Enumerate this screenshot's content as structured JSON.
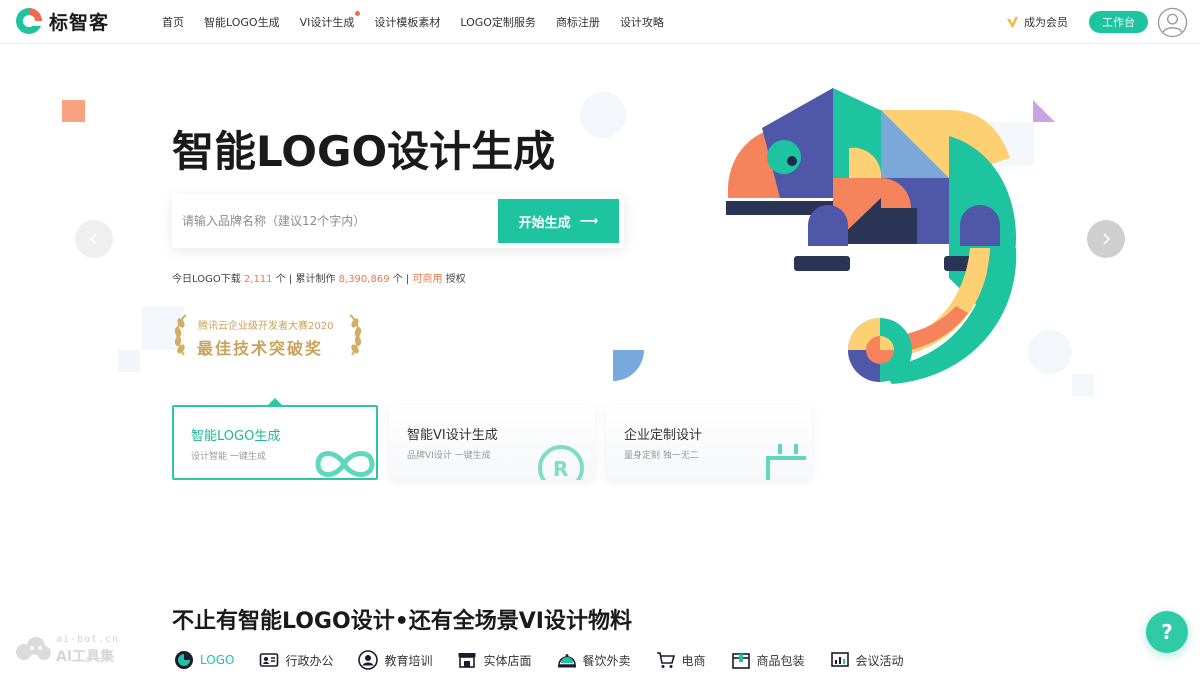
{
  "brand": {
    "name": "标智客",
    "color_primary": "#1ec4a0",
    "color_accent": "#f0784b"
  },
  "nav": {
    "items": [
      {
        "label": "首页"
      },
      {
        "label": "智能LOGO生成"
      },
      {
        "label": "VI设计生成",
        "dot": true
      },
      {
        "label": "设计模板素材"
      },
      {
        "label": "LOGO定制服务"
      },
      {
        "label": "商标注册"
      },
      {
        "label": "设计攻略"
      }
    ],
    "vip_label": "成为会员",
    "workbench_label": "工作台"
  },
  "hero": {
    "title": "智能LOGO设计生成",
    "search": {
      "placeholder": "请输入品牌名称（建议12个字内）",
      "value": "",
      "button_label": "开始生成",
      "button_arrow": "⟶"
    },
    "stats": {
      "prefix": "今日LOGO下载",
      "downloads": "2,111",
      "unit1": "个 | 累计制作",
      "total": "8,390,869",
      "unit2": "个 |",
      "commercial": "可商用",
      "suffix": "授权"
    },
    "award": {
      "line1": "腾讯云企业级开发者大赛2020",
      "line2": "最佳技术突破奖"
    }
  },
  "cards": [
    {
      "title": "智能LOGO生成",
      "subtitle": "设计智能 一键生成",
      "active": true,
      "icon": "infinity-icon"
    },
    {
      "title": "智能VI设计生成",
      "subtitle": "品牌VI设计 一键生成",
      "active": false,
      "icon": "registered-icon"
    },
    {
      "title": "企业定制设计",
      "subtitle": "量身定制 独一无二",
      "active": false,
      "icon": "custom-frame-icon"
    }
  ],
  "section": {
    "title": "不止有智能LOGO设计•还有全场景VI设计物料",
    "categories": [
      {
        "label": "LOGO",
        "icon": "logo-icon",
        "active": true
      },
      {
        "label": "行政办公",
        "icon": "id-card-icon"
      },
      {
        "label": "教育培训",
        "icon": "teacher-icon"
      },
      {
        "label": "实体店面",
        "icon": "storefront-icon"
      },
      {
        "label": "餐饮外卖",
        "icon": "food-cloche-icon"
      },
      {
        "label": "电商",
        "icon": "cart-icon"
      },
      {
        "label": "商品包装",
        "icon": "package-icon"
      },
      {
        "label": "会议活动",
        "icon": "chart-board-icon"
      }
    ]
  },
  "watermark": {
    "url": "ai-bot.cn",
    "name": "AI工具集"
  },
  "help": {
    "label": "?"
  }
}
